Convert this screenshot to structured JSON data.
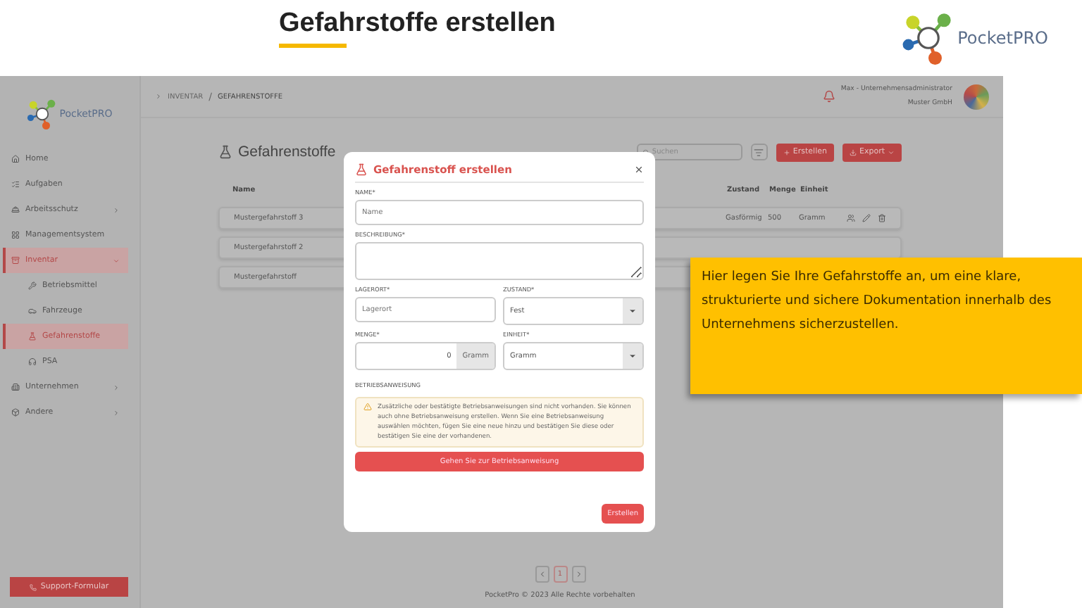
{
  "slide": {
    "title": "Gefahrstoffe erstellen",
    "logo_text": "PocketPRO"
  },
  "sidebar": {
    "logo_text": "PocketPRO",
    "items": [
      {
        "label": "Home",
        "kind": "link",
        "selected": false
      },
      {
        "label": "Aufgaben",
        "kind": "link",
        "selected": false
      },
      {
        "label": "Arbeitsschutz",
        "kind": "group",
        "selected": false,
        "expanded": false
      },
      {
        "label": "Managementsystem",
        "kind": "link",
        "selected": false
      },
      {
        "label": "Inventar",
        "kind": "group",
        "selected": true,
        "expanded": true,
        "children": [
          {
            "label": "Betriebsmittel",
            "selected": false
          },
          {
            "label": "Fahrzeuge",
            "selected": false
          },
          {
            "label": "Gefahrenstoffe",
            "selected": true
          },
          {
            "label": "PSA",
            "selected": false
          }
        ]
      },
      {
        "label": "Unternehmen",
        "kind": "group",
        "selected": false,
        "expanded": false
      },
      {
        "label": "Andere",
        "kind": "group",
        "selected": false,
        "expanded": false
      }
    ],
    "support_button": "Support-Formular"
  },
  "topbar": {
    "breadcrumb": [
      "INVENTAR",
      "GEFAHRENSTOFFE"
    ],
    "breadcrumb_separator": "/",
    "user": "Max - Unternehmensadministrator",
    "company": "Muster GmbH"
  },
  "page": {
    "title": "Gefahrenstoffe",
    "search_placeholder": "Suchen",
    "create_button": "Erstellen",
    "export_button": "Export",
    "columns": [
      "Name",
      "Zustand",
      "Menge",
      "Einheit"
    ],
    "rows": [
      {
        "name": "Mustergefahrstoff 3",
        "state": "Gasförmig",
        "amount": "500",
        "unit": "Gramm"
      },
      {
        "name": "Mustergefahrstoff 2"
      },
      {
        "name": "Mustergefahrstoff"
      }
    ],
    "pages": [
      {
        "label": "1",
        "selected": true
      }
    ],
    "footer": "PocketPro © 2023 Alle Rechte vorbehalten"
  },
  "modal": {
    "title": "Gefahrenstoff erstellen",
    "fields": [
      {
        "label": "NAME*",
        "kind": "text",
        "placeholder": "Name"
      },
      {
        "label": "BESCHREIBUNG*",
        "kind": "textarea"
      },
      {
        "label": "LAGERORT*",
        "kind": "text",
        "placeholder": "Lagerort"
      },
      {
        "label": "ZUSTAND*",
        "kind": "select",
        "value": "Fest"
      },
      {
        "label": "MENGE*",
        "kind": "number",
        "value": "0",
        "suffix": "Gramm"
      },
      {
        "label": "EINHEIT*",
        "kind": "select",
        "value": "Gramm"
      }
    ],
    "section_label": "BETRIEBSANWEISUNG",
    "warning": "Zusätzliche oder bestätigte Betriebsanweisungen sind nicht vorhanden. Sie können auch ohne Betriebsanweisung erstellen. Wenn Sie eine Betriebsanweisung auswählen möchten, fügen Sie eine neue hinzu und bestätigen Sie diese oder bestätigen Sie eine der vorhandenen.",
    "link_button": "Gehen Sie zur Betriebsanweisung",
    "submit_button": "Erstellen"
  },
  "callout": "Hier legen Sie Ihre Gefahrstoffe an, um eine klare, strukturierte und sichere Dokumentation innerhalb des Unternehmens sicherzustellen."
}
